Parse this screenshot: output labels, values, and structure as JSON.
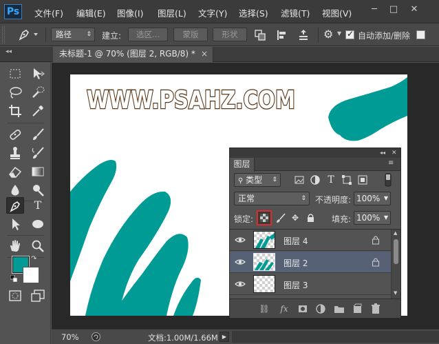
{
  "app": {
    "logo": "Ps"
  },
  "menu": [
    "文件(F)",
    "编辑(E)",
    "图像(I)",
    "图层(L)",
    "文字(Y)",
    "选择(S)",
    "滤镜(T)",
    "视图(V)"
  ],
  "window_controls": {
    "minimize": "─",
    "restore": "□",
    "close": "✕"
  },
  "options": {
    "mode_value": "路径",
    "build_label": "建立:",
    "selection_button": "选区...",
    "mask_button": "蒙版",
    "shape_button": "形状",
    "auto_add_delete_label": "自动添加/删除",
    "auto_add_delete_checked": true
  },
  "document": {
    "tab_title": "未标题-1 @ 70% (图层 2, RGB/8) *",
    "tab_close": "×",
    "canvas_text": "WWW.PSAHZ.COM",
    "shape_color": "#009b94"
  },
  "colors": {
    "foreground": "#009b94",
    "background": "#ffffff"
  },
  "status": {
    "zoom": "70%",
    "doc_info": "文档:1.00M/1.66M"
  },
  "layers_panel": {
    "tab": "图层",
    "filter_value": "类型",
    "blend_mode": "正常",
    "opacity_label": "不透明度:",
    "opacity_value": "100%",
    "lock_label": "锁定:",
    "fill_label": "填充:",
    "fill_value": "100%",
    "layers": [
      {
        "name": "图层 4",
        "selected": false,
        "locked": true
      },
      {
        "name": "图层 2",
        "selected": true,
        "locked": true
      },
      {
        "name": "图层 3",
        "selected": false,
        "locked": false
      }
    ],
    "footer_icons": [
      "link-icon",
      "fx-icon",
      "mask-icon",
      "adjustment-icon",
      "group-icon",
      "new-layer-icon",
      "trash-icon"
    ]
  }
}
